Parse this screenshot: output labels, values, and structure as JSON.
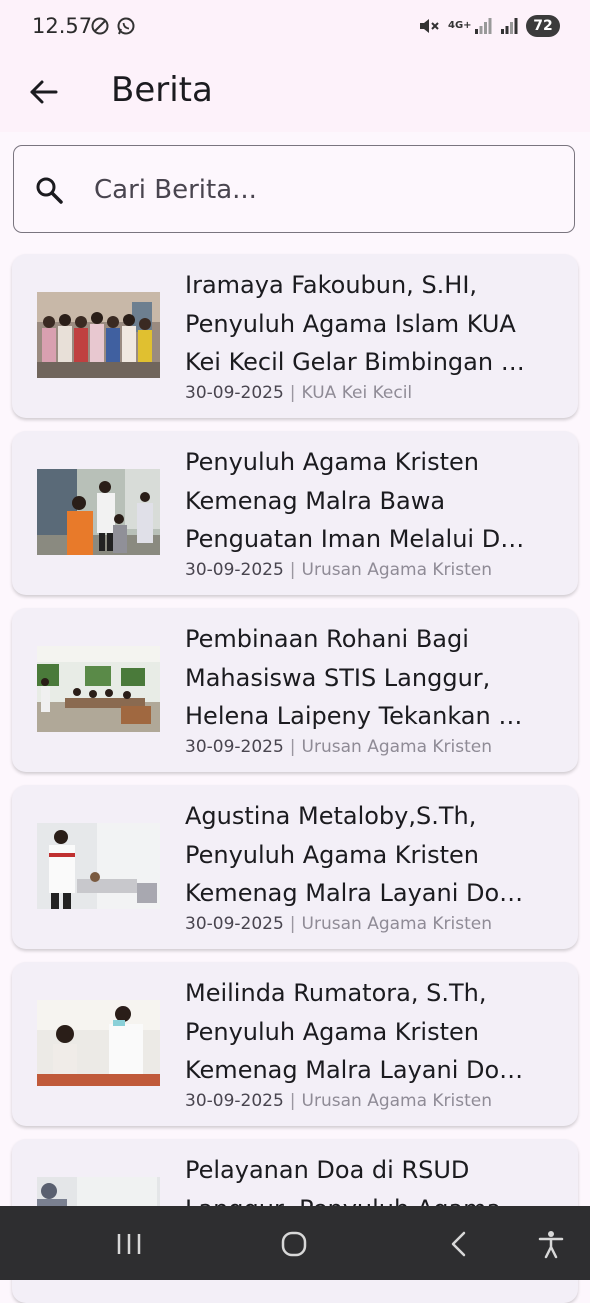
{
  "status_bar": {
    "time": "12.57",
    "battery": "72",
    "network_label": "4G+"
  },
  "app_bar": {
    "title": "Berita",
    "back_icon": "arrow-left-icon"
  },
  "search": {
    "placeholder": "Cari Berita...",
    "icon": "search-icon"
  },
  "news": [
    {
      "title": "Iramaya Fakoubun, S.HI, Penyuluh Agama Islam KUA Kei Kecil Gelar Bimbingan …",
      "date": "30-09-2025",
      "separator": "|",
      "category": "KUA Kei Kecil"
    },
    {
      "title": "Penyuluh Agama Kristen Kemenag Malra Bawa Penguatan Iman Melalui D…",
      "date": "30-09-2025",
      "separator": "|",
      "category": "Urusan Agama Kristen"
    },
    {
      "title": "Pembinaan Rohani Bagi Mahasiswa STIS Langgur, Helena Laipeny Tekankan …",
      "date": "30-09-2025",
      "separator": "|",
      "category": "Urusan Agama Kristen"
    },
    {
      "title": "Agustina Metaloby,S.Th, Penyuluh Agama Kristen Kemenag Malra Layani Do…",
      "date": "30-09-2025",
      "separator": "|",
      "category": "Urusan Agama Kristen"
    },
    {
      "title": "Meilinda Rumatora, S.Th, Penyuluh Agama Kristen Kemenag Malra Layani Do…",
      "date": "30-09-2025",
      "separator": "|",
      "category": "Urusan Agama Kristen"
    },
    {
      "title": "Pelayanan Doa di RSUD Langgur, Penyuluh Agama",
      "date": "",
      "separator": "",
      "category": ""
    }
  ],
  "nav_bar": {
    "items": [
      "recent-apps-icon",
      "home-icon",
      "back-icon",
      "accessibility-icon"
    ]
  }
}
